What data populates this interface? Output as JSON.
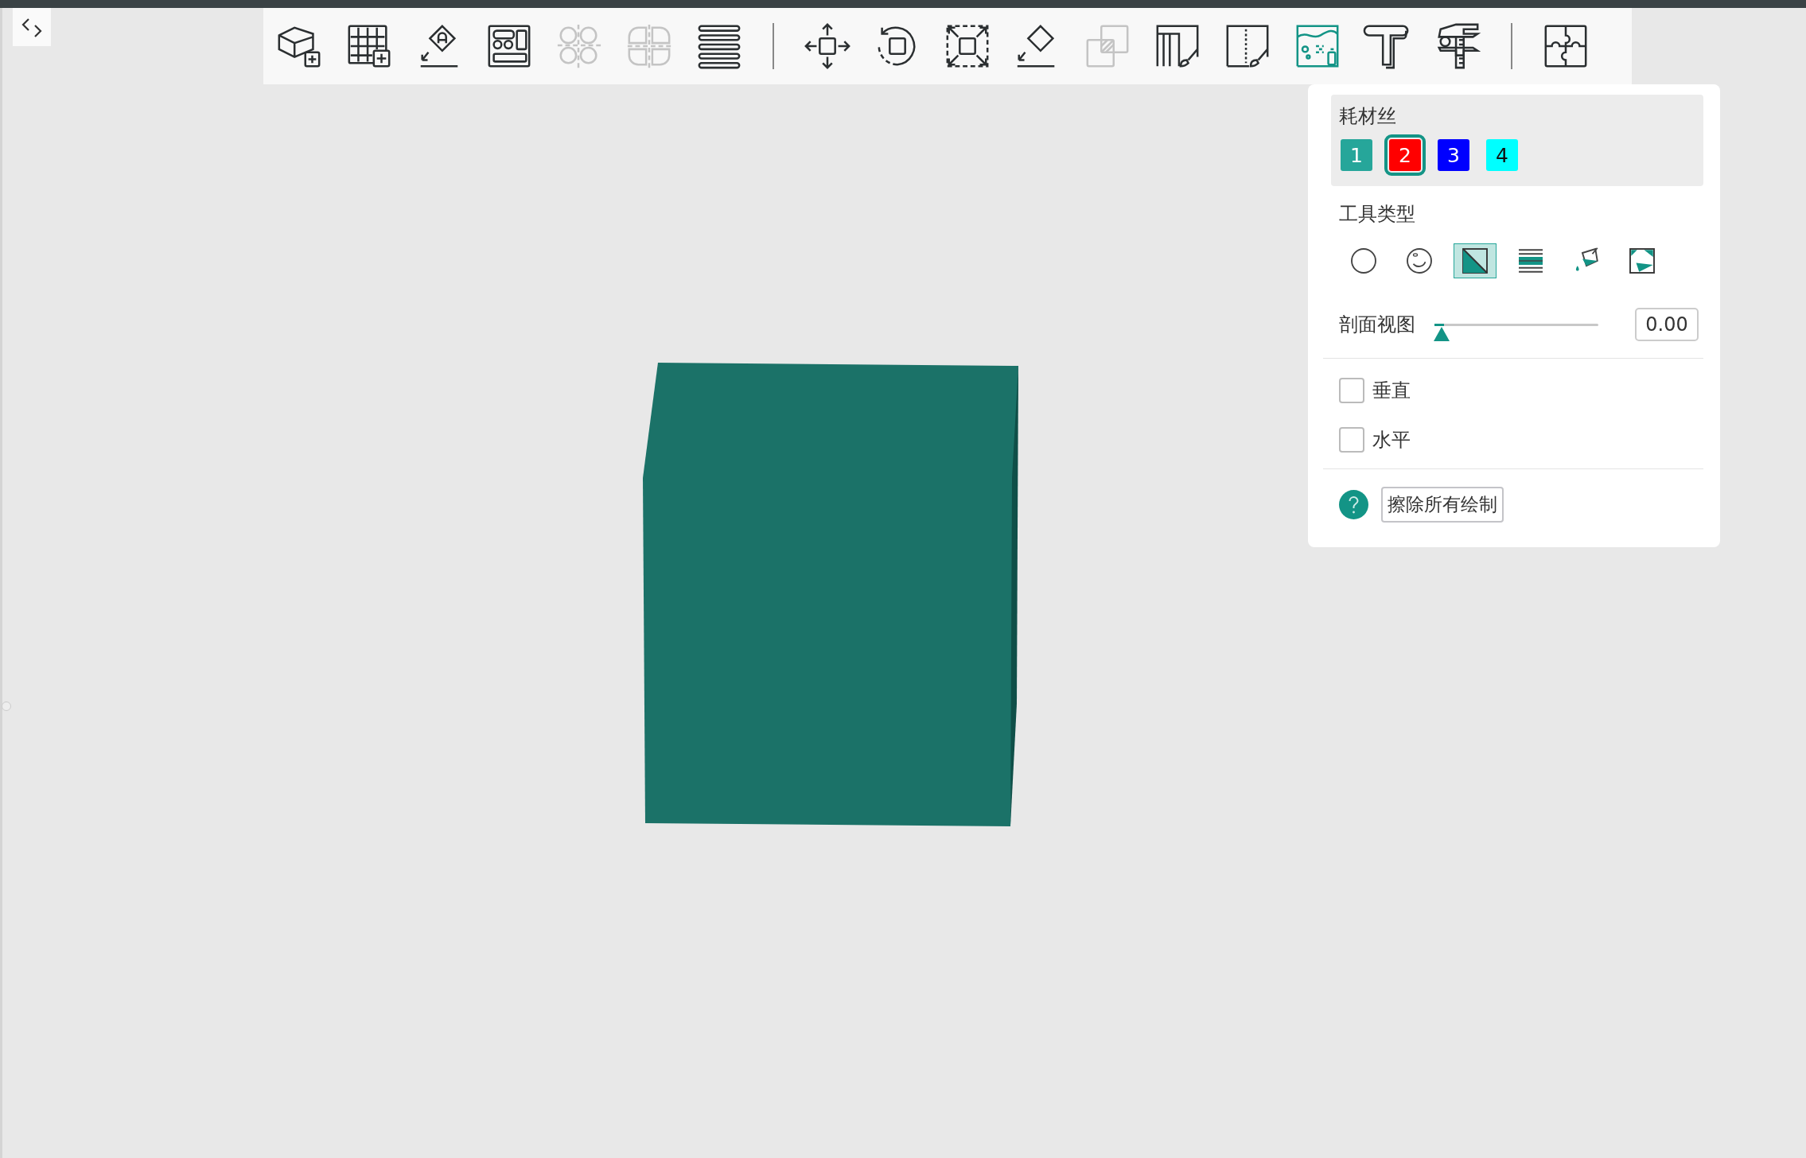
{
  "toolbar": {
    "groups": [
      [
        {
          "selected": false,
          "disabled": false
        },
        {
          "selected": false,
          "disabled": false
        },
        {
          "selected": false,
          "disabled": false
        },
        {
          "selected": false,
          "disabled": false
        },
        {
          "selected": false,
          "disabled": true
        },
        {
          "selected": false,
          "disabled": true
        },
        {
          "selected": false,
          "disabled": false
        }
      ],
      [
        {
          "selected": false,
          "disabled": false
        },
        {
          "selected": false,
          "disabled": false
        },
        {
          "selected": false,
          "disabled": false
        },
        {
          "selected": false,
          "disabled": false
        },
        {
          "selected": false,
          "disabled": true
        },
        {
          "selected": false,
          "disabled": false
        },
        {
          "selected": false,
          "disabled": false
        },
        {
          "selected": true,
          "disabled": false
        },
        {
          "selected": false,
          "disabled": false
        },
        {
          "selected": false,
          "disabled": false
        }
      ],
      [
        {
          "selected": false,
          "disabled": false
        }
      ]
    ]
  },
  "panel": {
    "filament": {
      "title": "耗材丝",
      "swatches": [
        {
          "label": "1",
          "color": "#26a69a",
          "selected": false
        },
        {
          "label": "2",
          "color": "#ff0000",
          "selected": true
        },
        {
          "label": "3",
          "color": "#0000ff",
          "selected": false
        },
        {
          "label": "4",
          "color": "#00ffff",
          "selected": false
        }
      ]
    },
    "tool_type": {
      "title": "工具类型",
      "tools": [
        {
          "selected": false
        },
        {
          "selected": false
        },
        {
          "selected": true
        },
        {
          "selected": false
        },
        {
          "selected": false
        },
        {
          "selected": false
        }
      ]
    },
    "section_view": {
      "label": "剖面视图",
      "level": 0,
      "value": "0.00"
    },
    "options": [
      {
        "label": "垂直",
        "checked": false
      },
      {
        "label": "水平",
        "checked": false
      }
    ],
    "clear_button": "擦除所有绘制"
  }
}
